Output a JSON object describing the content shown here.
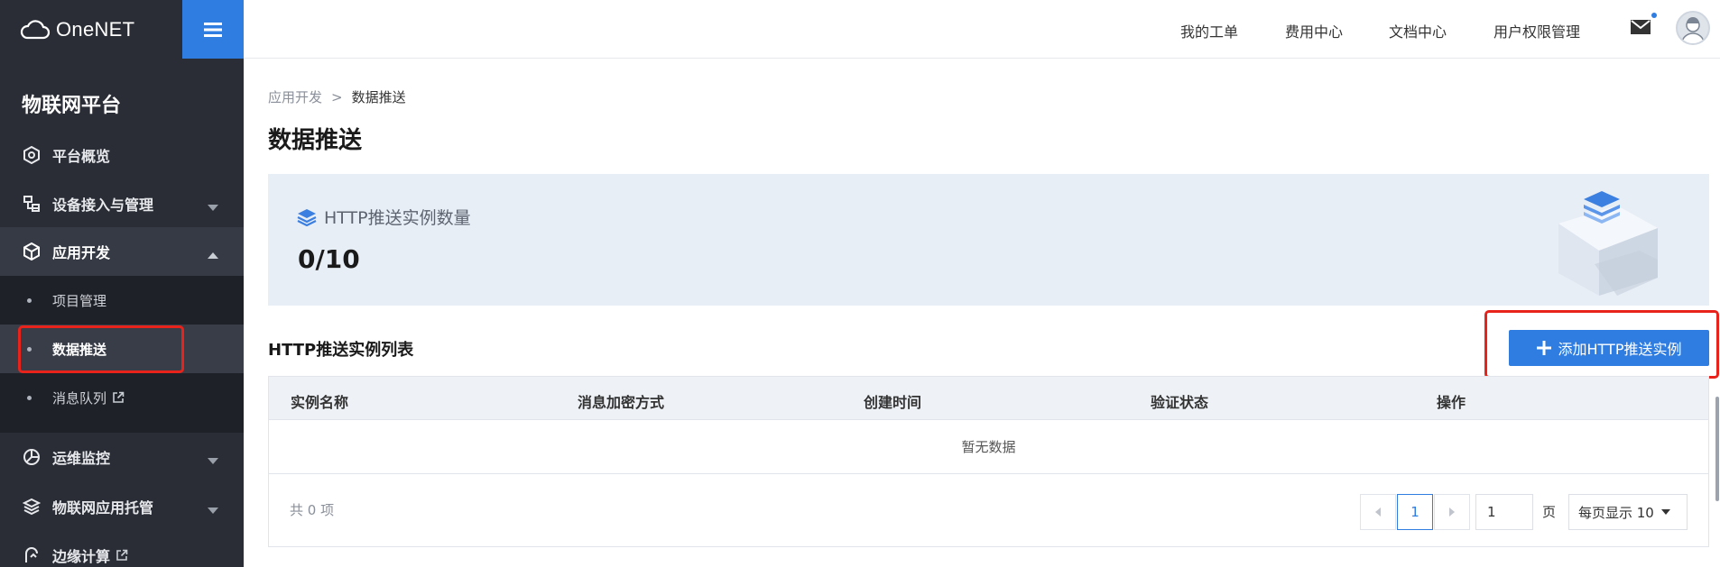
{
  "brand": {
    "logo_text": "OneNET"
  },
  "sidebar": {
    "platform_title": "物联网平台",
    "items": [
      {
        "label": "平台概览",
        "icon": "platform-overview-icon"
      },
      {
        "label": "设备接入与管理",
        "icon": "device-access-icon",
        "caret": "down"
      },
      {
        "label": "应用开发",
        "icon": "app-dev-icon",
        "caret": "up",
        "expanded": true
      },
      {
        "label": "运维监控",
        "icon": "monitoring-icon",
        "caret": "down"
      },
      {
        "label": "物联网应用托管",
        "icon": "hosting-icon",
        "caret": "down"
      },
      {
        "label": "边缘计算",
        "icon": "edge-computing-icon",
        "external": true
      }
    ],
    "subitems": [
      {
        "label": "项目管理"
      },
      {
        "label": "数据推送",
        "active": true
      },
      {
        "label": "消息队列",
        "external": true
      }
    ]
  },
  "header": {
    "links": [
      "我的工单",
      "费用中心",
      "文档中心",
      "用户权限管理"
    ]
  },
  "breadcrumb": {
    "parent": "应用开发",
    "separator": ">",
    "current": "数据推送"
  },
  "page_title": "数据推送",
  "stats": {
    "label": "HTTP推送实例数量",
    "value": "0/10"
  },
  "list": {
    "title": "HTTP推送实例列表",
    "add_button": "添加HTTP推送实例",
    "columns": [
      "实例名称",
      "消息加密方式",
      "创建时间",
      "验证状态",
      "操作"
    ],
    "empty_text": "暂无数据",
    "total_text": "共 0 项",
    "current_page": "1",
    "jump_value": "1",
    "page_unit": "页",
    "page_size_label": "每页显示 10"
  },
  "colors": {
    "accent": "#2f7de1",
    "sidebar_bg": "#2a2d35",
    "highlight": "#e8231b"
  }
}
